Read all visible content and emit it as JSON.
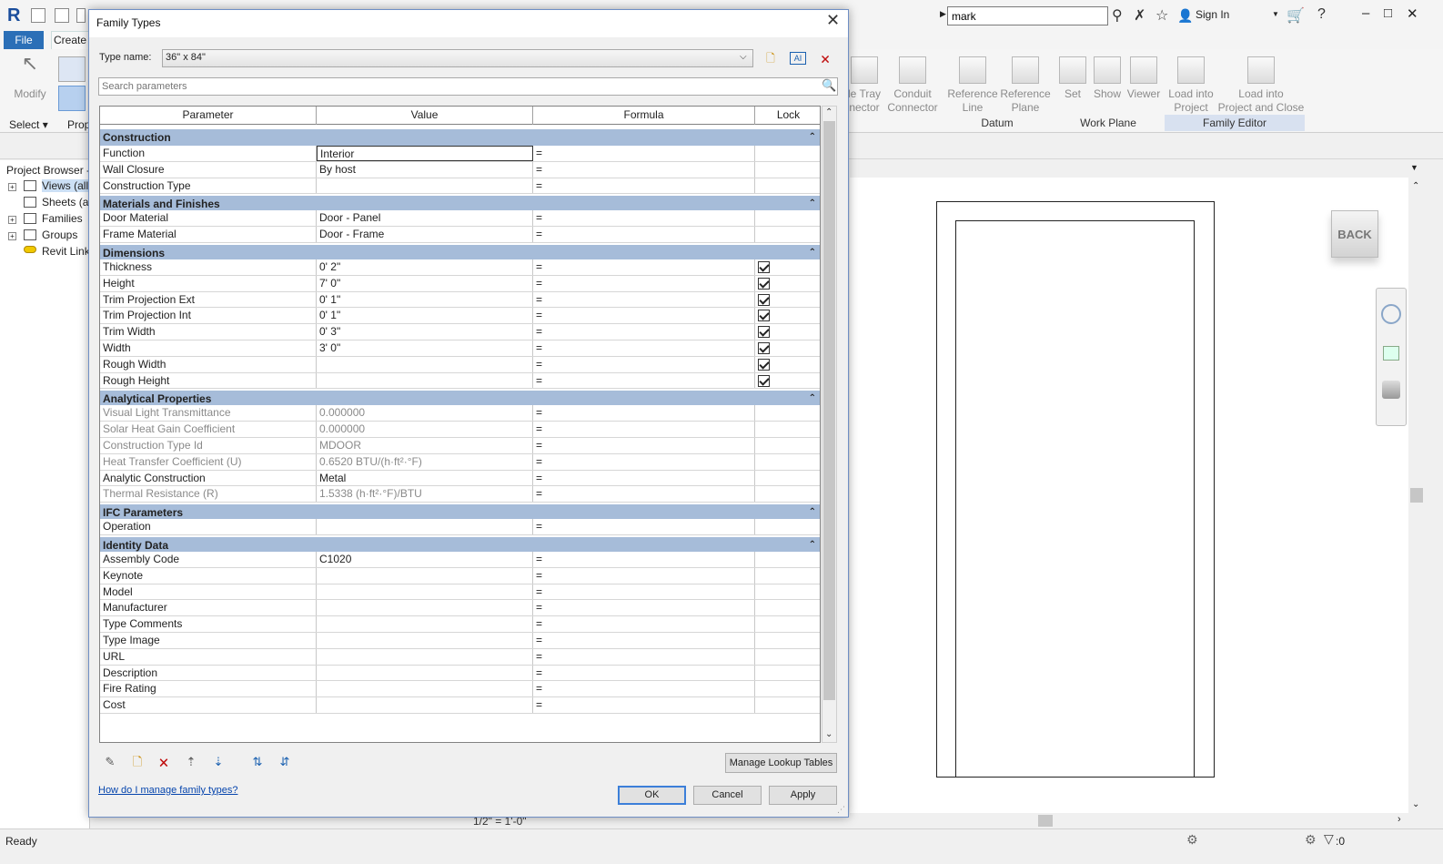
{
  "app": {
    "logo": "R",
    "search_value": "mark",
    "sign_in": "Sign In",
    "tabs": {
      "file": "File",
      "create": "Create"
    },
    "ribbon": {
      "modify": "Modify",
      "select": "Select",
      "prop_short": "Prop",
      "cable_tray": "le Tray\nnector",
      "conduit": "Conduit\nConnector",
      "ref_line": "Reference\nLine",
      "ref_plane": "Reference\nPlane",
      "set": "Set",
      "show": "Show",
      "viewer": "Viewer",
      "load_into_project": "Load into\nProject",
      "load_close": "Load into\nProject and Close",
      "groups": {
        "datum": "Datum",
        "work_plane": "Work Plane",
        "family_editor": "Family Editor"
      }
    },
    "project_browser": {
      "title": "Project Browser -",
      "items": [
        "Views (all)",
        "Sheets (al",
        "Families",
        "Groups",
        "Revit Link"
      ]
    },
    "viewcube": "BACK",
    "status": "Ready",
    "scale": "1/2\" = 1'-0\"",
    "filter_count": ":0"
  },
  "dialog": {
    "title": "Family Types",
    "type_name_label": "Type name:",
    "type_name_value": "36\" x 84\"",
    "search_placeholder": "Search parameters",
    "columns": {
      "parameter": "Parameter",
      "value": "Value",
      "formula": "Formula",
      "lock": "Lock"
    },
    "groups": [
      {
        "name": "Construction",
        "rows": [
          {
            "param": "Function",
            "value": "Interior",
            "formula": "=",
            "lock": false,
            "selected": true
          },
          {
            "param": "Wall Closure",
            "value": "By host",
            "formula": "=",
            "lock": false
          },
          {
            "param": "Construction Type",
            "value": "",
            "formula": "=",
            "lock": false
          }
        ]
      },
      {
        "name": "Materials and Finishes",
        "rows": [
          {
            "param": "Door Material",
            "value": "Door - Panel",
            "formula": "=",
            "lock": false
          },
          {
            "param": "Frame Material",
            "value": "Door - Frame",
            "formula": "=",
            "lock": false
          }
        ]
      },
      {
        "name": "Dimensions",
        "rows": [
          {
            "param": "Thickness",
            "value": "0'  2\"",
            "formula": "=",
            "lock": true
          },
          {
            "param": "Height",
            "value": "7'  0\"",
            "formula": "=",
            "lock": true
          },
          {
            "param": "Trim Projection Ext",
            "value": "0'  1\"",
            "formula": "=",
            "lock": true
          },
          {
            "param": "Trim Projection Int",
            "value": "0'  1\"",
            "formula": "=",
            "lock": true
          },
          {
            "param": "Trim Width",
            "value": "0'  3\"",
            "formula": "=",
            "lock": true
          },
          {
            "param": "Width",
            "value": "3'  0\"",
            "formula": "=",
            "lock": true
          },
          {
            "param": "Rough Width",
            "value": "",
            "formula": "=",
            "lock": true
          },
          {
            "param": "Rough Height",
            "value": "",
            "formula": "=",
            "lock": true
          }
        ]
      },
      {
        "name": "Analytical Properties",
        "rows": [
          {
            "param": "Visual Light Transmittance",
            "value": "0.000000",
            "formula": "=",
            "lock": false,
            "readonly": true
          },
          {
            "param": "Solar Heat Gain Coefficient",
            "value": "0.000000",
            "formula": "=",
            "lock": false,
            "readonly": true
          },
          {
            "param": "Construction Type Id",
            "value": "MDOOR",
            "formula": "=",
            "lock": false,
            "readonly": true
          },
          {
            "param": "Heat Transfer Coefficient (U)",
            "value": "0.6520 BTU/(h·ft²·°F)",
            "formula": "=",
            "lock": false,
            "readonly": true
          },
          {
            "param": "Analytic Construction",
            "value": "Metal",
            "formula": "=",
            "lock": false
          },
          {
            "param": "Thermal Resistance (R)",
            "value": "1.5338 (h·ft²·°F)/BTU",
            "formula": "=",
            "lock": false,
            "readonly": true
          }
        ]
      },
      {
        "name": "IFC Parameters",
        "rows": [
          {
            "param": "Operation",
            "value": "",
            "formula": "=",
            "lock": false
          }
        ]
      },
      {
        "name": "Identity Data",
        "rows": [
          {
            "param": "Assembly Code",
            "value": "C1020",
            "formula": "=",
            "lock": false
          },
          {
            "param": "Keynote",
            "value": "",
            "formula": "=",
            "lock": false
          },
          {
            "param": "Model",
            "value": "",
            "formula": "=",
            "lock": false
          },
          {
            "param": "Manufacturer",
            "value": "",
            "formula": "=",
            "lock": false
          },
          {
            "param": "Type Comments",
            "value": "",
            "formula": "=",
            "lock": false
          },
          {
            "param": "Type Image",
            "value": "",
            "formula": "=",
            "lock": false
          },
          {
            "param": "URL",
            "value": "",
            "formula": "=",
            "lock": false
          },
          {
            "param": "Description",
            "value": "",
            "formula": "=",
            "lock": false
          },
          {
            "param": "Fire Rating",
            "value": "",
            "formula": "=",
            "lock": false
          },
          {
            "param": "Cost",
            "value": "",
            "formula": "=",
            "lock": false
          }
        ]
      }
    ],
    "manage_lookup": "Manage Lookup Tables",
    "help_link": "How do I manage family types?",
    "buttons": {
      "ok": "OK",
      "cancel": "Cancel",
      "apply": "Apply"
    }
  }
}
